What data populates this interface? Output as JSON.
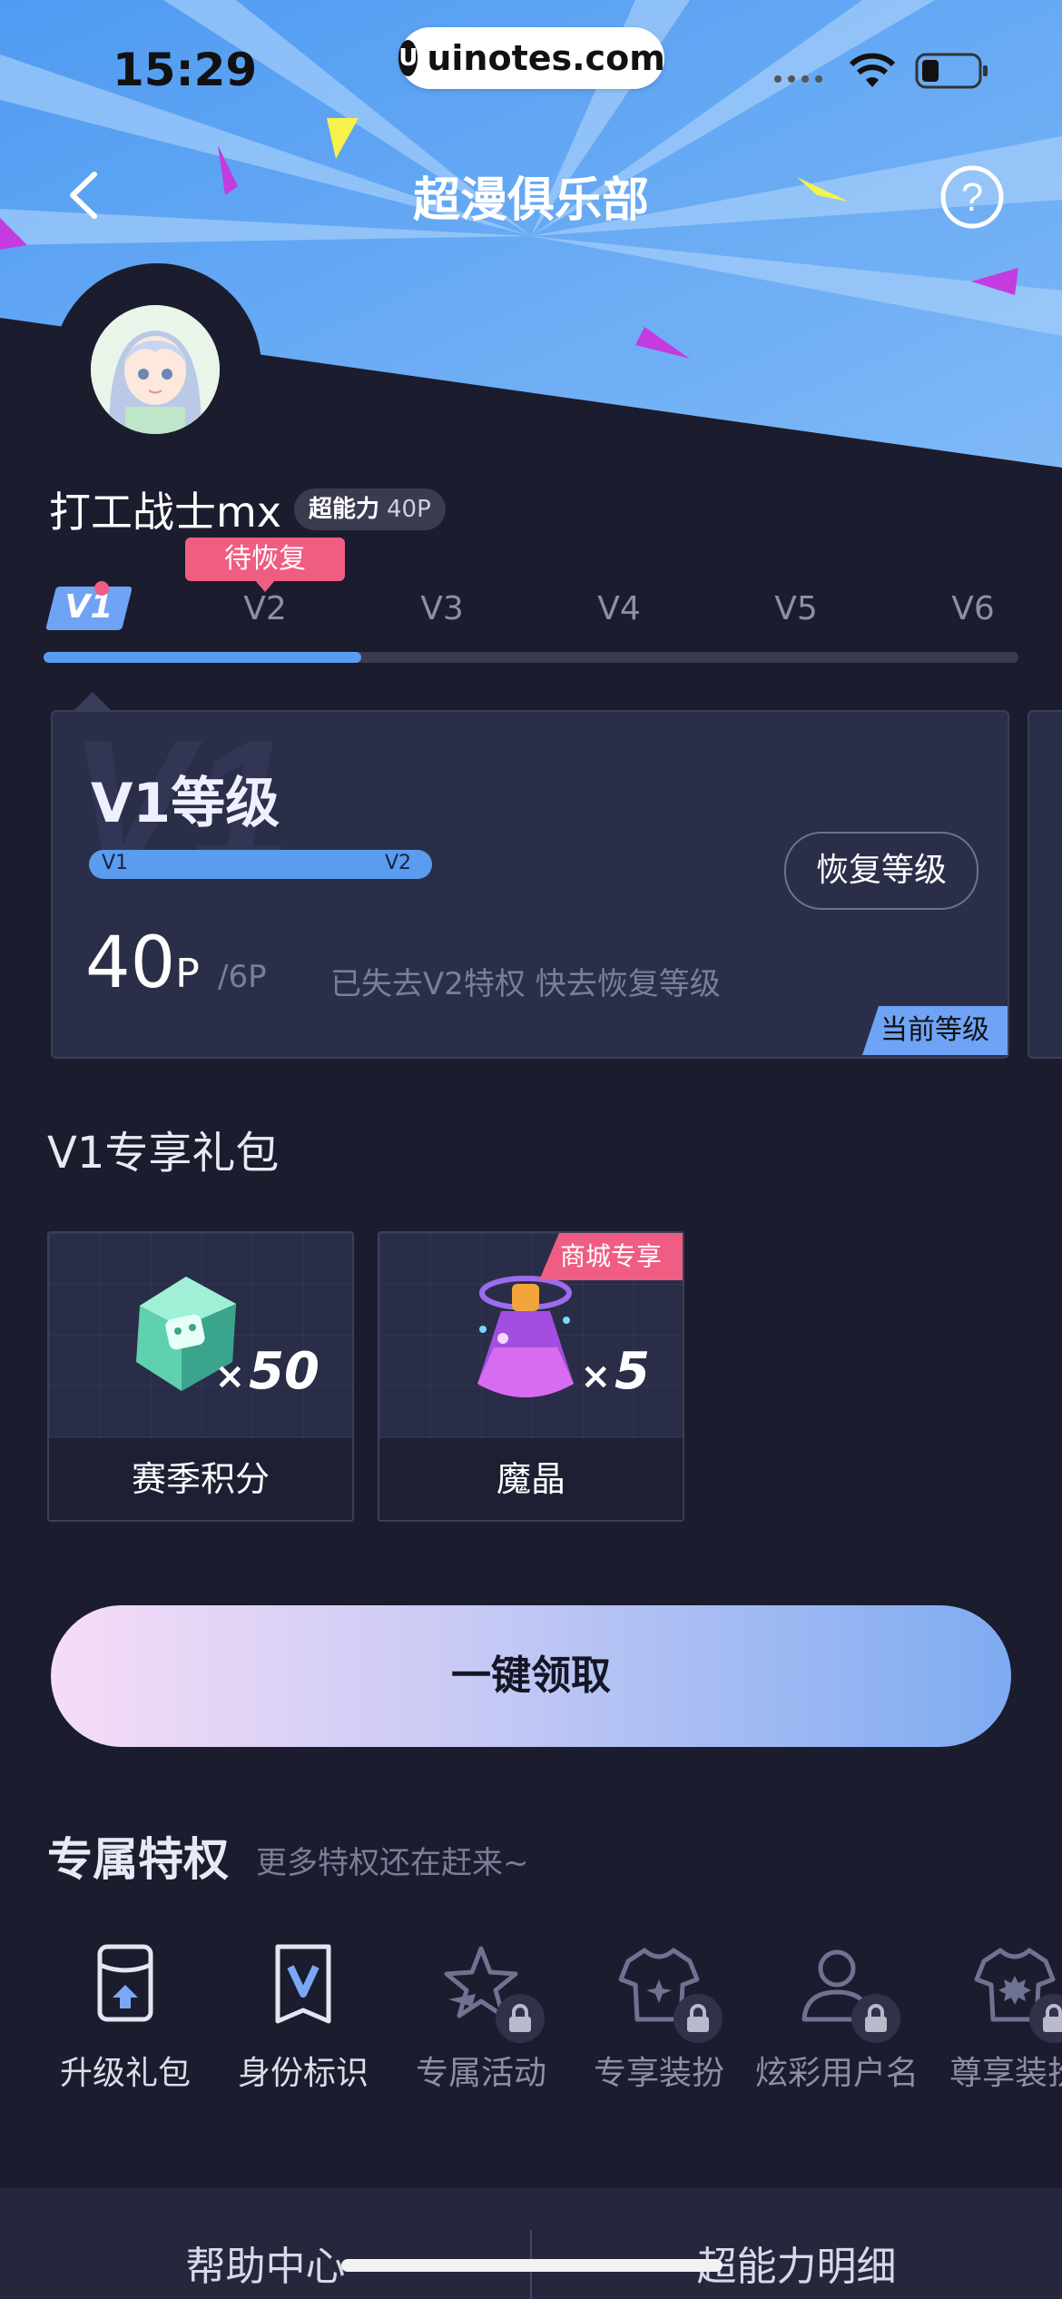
{
  "status": {
    "time": "15:29",
    "url": "uinotes.com",
    "url_logo": "U"
  },
  "nav": {
    "title": "超漫俱乐部",
    "back_icon": "chevron-left-icon",
    "help_icon": "question-circle-icon",
    "help_glyph": "?"
  },
  "profile": {
    "username": "打工战士mx",
    "power_label": "超能力",
    "power_value": "40P"
  },
  "levels": {
    "pending_tag": "待恢复",
    "items": [
      "V1",
      "V2",
      "V3",
      "V4",
      "V5",
      "V6"
    ],
    "current": "V1",
    "progress": 0.33
  },
  "level_card": {
    "title": "V1等级",
    "bar_from": "V1",
    "bar_to": "V2",
    "restore_button": "恢复等级",
    "points": "40",
    "points_unit": "P",
    "points_total": "/6P",
    "lost_text": "已失去V2特权 快去恢复等级",
    "current_tag": "当前等级"
  },
  "gifts": {
    "title": "V1专享礼包",
    "items": [
      {
        "label": "赛季积分",
        "qty_prefix": "×",
        "qty": "50",
        "tag": ""
      },
      {
        "label": "魔晶",
        "qty_prefix": "×",
        "qty": "5",
        "tag": "商城专享"
      }
    ]
  },
  "claim_button": "一键领取",
  "privileges": {
    "title": "专属特权",
    "subtitle": "更多特权还在赶来~",
    "items": [
      {
        "label": "升级礼包",
        "icon": "gift-upgrade-icon",
        "locked": false
      },
      {
        "label": "身份标识",
        "icon": "v-badge-icon",
        "locked": false
      },
      {
        "label": "专属活动",
        "icon": "star-activity-icon",
        "locked": true
      },
      {
        "label": "专享装扮",
        "icon": "tshirt-icon",
        "locked": true
      },
      {
        "label": "炫彩用户名",
        "icon": "user-icon",
        "locked": true
      },
      {
        "label": "尊享装扮",
        "icon": "tshirt-burst-icon",
        "locked": true
      }
    ]
  },
  "footer": {
    "help": "帮助中心",
    "power_detail": "超能力明细"
  }
}
